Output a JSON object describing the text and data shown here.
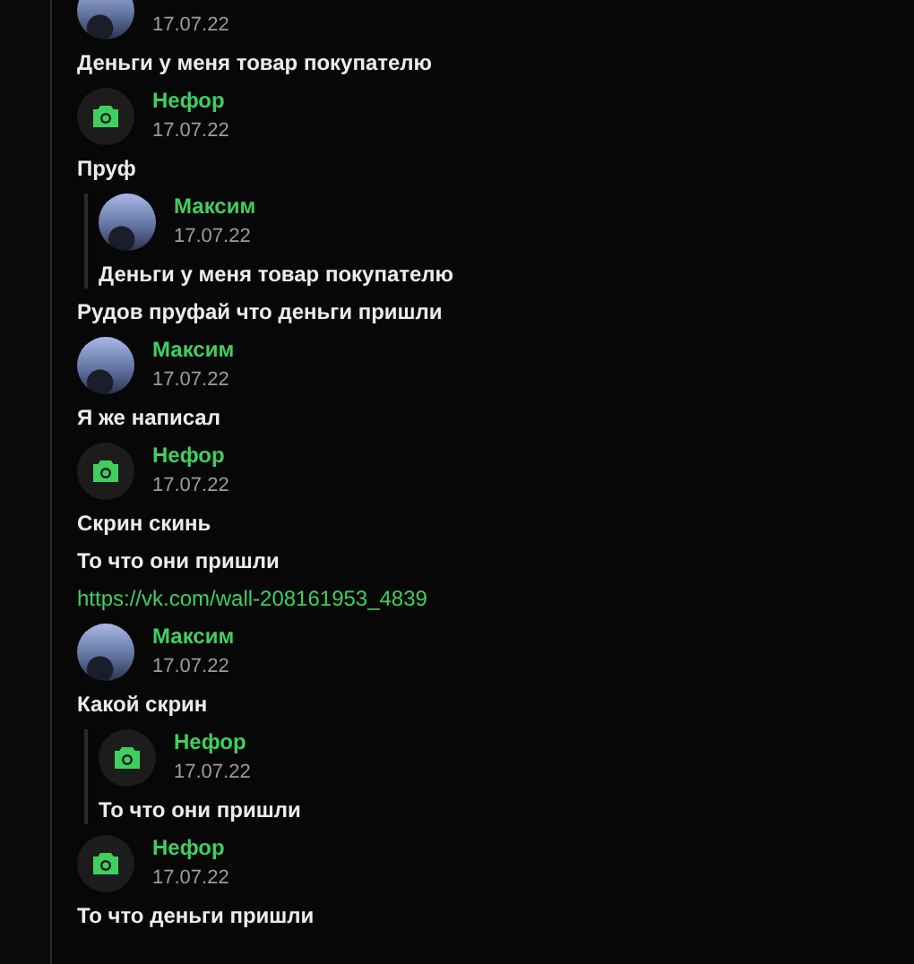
{
  "messages": [
    {
      "avatar": {
        "kind": "photo"
      },
      "date": "17.07.22",
      "lines": [
        {
          "kind": "text",
          "text": "Деньги у меня товар покупателю"
        }
      ]
    },
    {
      "avatar": {
        "kind": "camera"
      },
      "author": "Нефор",
      "date": "17.07.22",
      "lines": [
        {
          "kind": "text",
          "text": "Пруф"
        },
        {
          "kind": "quote",
          "avatar": {
            "kind": "photo"
          },
          "author": "Максим",
          "date": "17.07.22",
          "text": "Деньги у меня товар покупателю"
        },
        {
          "kind": "text",
          "text": "Рудов пруфай что деньги пришли"
        }
      ]
    },
    {
      "avatar": {
        "kind": "photo"
      },
      "author": "Максим",
      "date": "17.07.22",
      "lines": [
        {
          "kind": "text",
          "text": "Я же написал"
        }
      ]
    },
    {
      "avatar": {
        "kind": "camera"
      },
      "author": "Нефор",
      "date": "17.07.22",
      "lines": [
        {
          "kind": "text",
          "text": "Скрин скинь"
        },
        {
          "kind": "text",
          "text": "То что они пришли"
        },
        {
          "kind": "link",
          "text": "https://vk.com/wall-208161953_4839"
        }
      ]
    },
    {
      "avatar": {
        "kind": "photo"
      },
      "author": "Максим",
      "date": "17.07.22",
      "lines": [
        {
          "kind": "text",
          "text": "Какой скрин"
        },
        {
          "kind": "quote",
          "avatar": {
            "kind": "camera"
          },
          "author": "Нефор",
          "date": "17.07.22",
          "text": "То что они пришли"
        }
      ]
    },
    {
      "avatar": {
        "kind": "camera"
      },
      "author": "Нефор",
      "date": "17.07.22",
      "lines": [
        {
          "kind": "text",
          "text": "То что деньги пришли"
        }
      ]
    }
  ]
}
